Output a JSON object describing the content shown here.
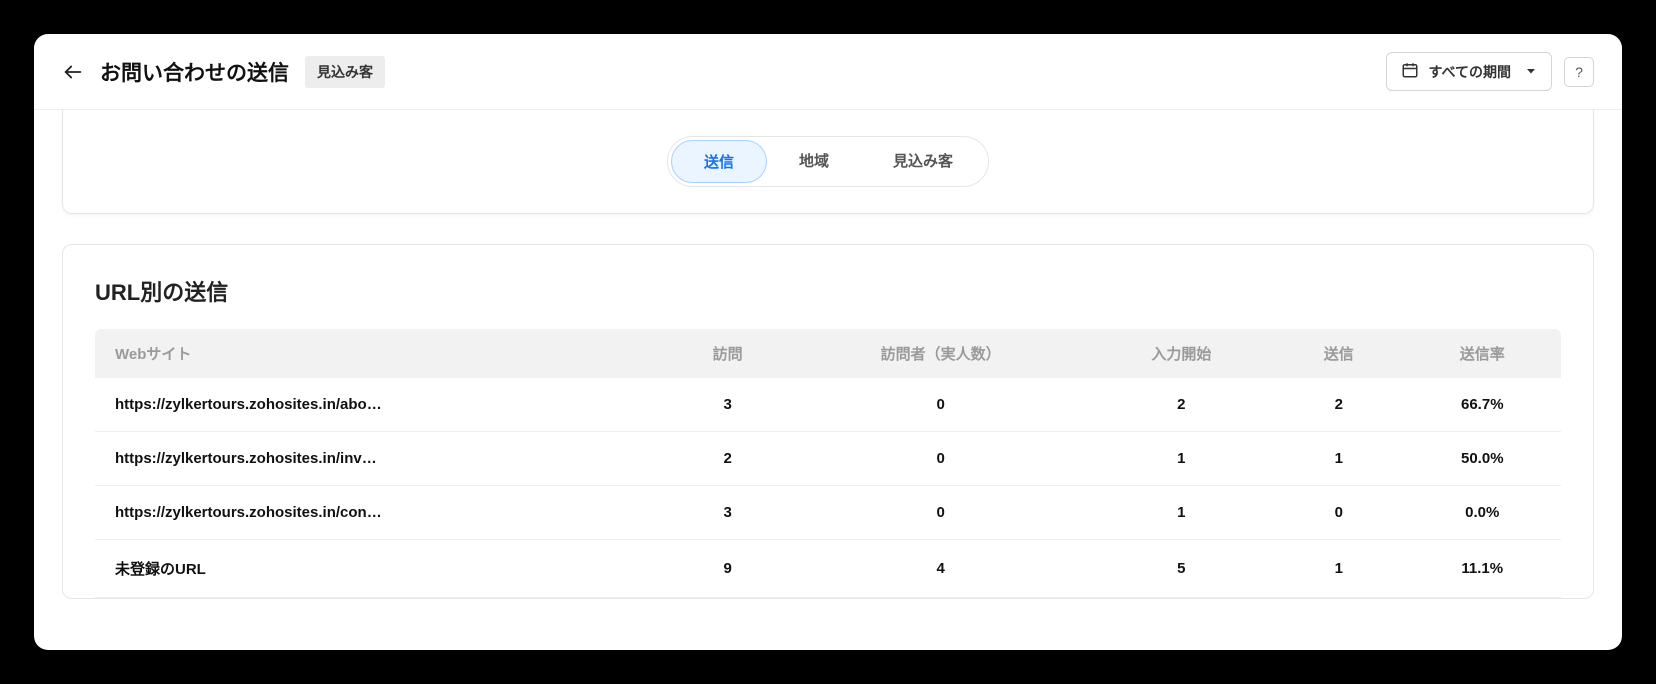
{
  "header": {
    "title": "お問い合わせの送信",
    "badge": "見込み客",
    "date_label": "すべての期間"
  },
  "tabs": {
    "items": [
      {
        "label": "送信",
        "active": true
      },
      {
        "label": "地域",
        "active": false
      },
      {
        "label": "見込み客",
        "active": false
      }
    ]
  },
  "table": {
    "title": "URL別の送信",
    "columns": [
      "Webサイト",
      "訪問",
      "訪問者（実人数）",
      "入力開始",
      "送信",
      "送信率"
    ],
    "rows": [
      {
        "site": "https://zylkertours.zohosites.in/abo…",
        "visits": "3",
        "uniques": "0",
        "started": "2",
        "submit": "2",
        "rate": "66.7%"
      },
      {
        "site": "https://zylkertours.zohosites.in/inv…",
        "visits": "2",
        "uniques": "0",
        "started": "1",
        "submit": "1",
        "rate": "50.0%"
      },
      {
        "site": "https://zylkertours.zohosites.in/con…",
        "visits": "3",
        "uniques": "0",
        "started": "1",
        "submit": "0",
        "rate": "0.0%"
      },
      {
        "site": "未登録のURL",
        "visits": "9",
        "uniques": "4",
        "started": "5",
        "submit": "1",
        "rate": "11.1%"
      }
    ]
  }
}
